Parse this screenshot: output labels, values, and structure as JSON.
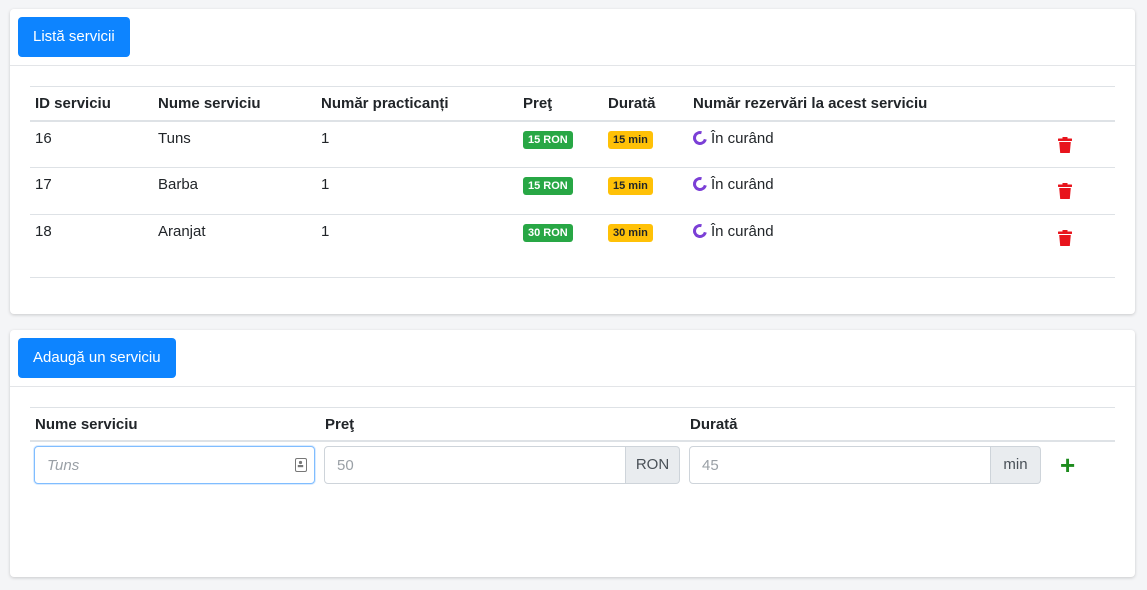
{
  "list_card": {
    "header_button": "Listă servicii",
    "columns": [
      "ID serviciu",
      "Nume serviciu",
      "Număr practicanți",
      "Preţ",
      "Durată",
      "Număr rezervări la acest serviciu"
    ],
    "rows": [
      {
        "id": "16",
        "name": "Tuns",
        "practitioners": "1",
        "price": "15 RON",
        "duration": "15 min",
        "bookings": "În curând"
      },
      {
        "id": "17",
        "name": "Barba",
        "practitioners": "1",
        "price": "15 RON",
        "duration": "15 min",
        "bookings": "În curând"
      },
      {
        "id": "18",
        "name": "Aranjat",
        "practitioners": "1",
        "price": "30 RON",
        "duration": "30 min",
        "bookings": "În curând"
      }
    ]
  },
  "add_card": {
    "header_button": "Adaugă un serviciu",
    "labels": {
      "name": "Nume serviciu",
      "price": "Preţ",
      "duration": "Durată"
    },
    "name_placeholder": "Tuns",
    "price_placeholder": "50",
    "price_addon": "RON",
    "duration_placeholder": "45",
    "duration_addon": "min",
    "add_symbol": "+"
  },
  "colors": {
    "primary": "#0d84ff",
    "badge_price": "#28a745",
    "badge_duration": "#ffc107",
    "spinner": "#7b3fd6",
    "delete": "#e8141c",
    "add": "#1e8c1e"
  },
  "icons": [
    "spinner-icon",
    "trash-icon",
    "plus-icon",
    "contact-card-icon"
  ]
}
